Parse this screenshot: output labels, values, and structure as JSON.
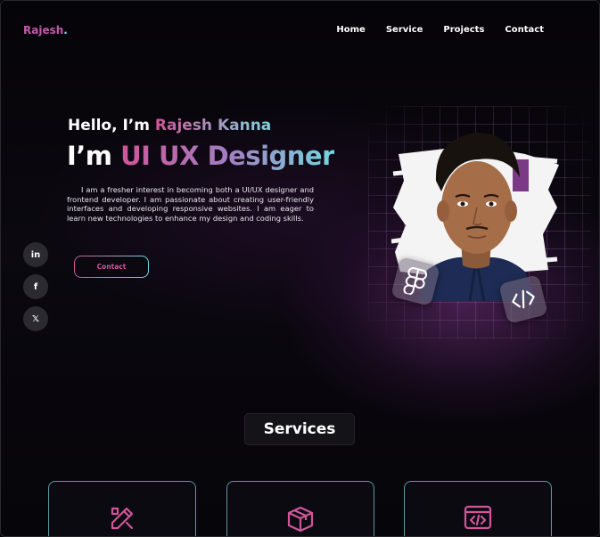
{
  "brand": {
    "name": "Rajesh",
    "dot": ".",
    "accent": "#c45aa8",
    "accent2": "#8fd8e6"
  },
  "nav": {
    "items": [
      "Home",
      "Service",
      "Projects",
      "Contact"
    ]
  },
  "hero": {
    "greeting": "Hello, I’m ",
    "name": "Rajesh Kanna",
    "role_prefix": "I’m ",
    "role": "UI UX Designer",
    "intro": "I am a fresher interest in becoming both a UI/UX designer and frontend developer. I am passionate about creating user-friendly interfaces and developing responsive websites. I am eager to learn new technologies to enhance my design and coding skills.",
    "contact_button": "Contact"
  },
  "socials": [
    {
      "icon": "linkedin-icon",
      "glyph": "in"
    },
    {
      "icon": "facebook-icon",
      "glyph": "f"
    },
    {
      "icon": "x-twitter-icon",
      "glyph": "𝕏"
    }
  ],
  "badges": {
    "left": "figma-icon",
    "right": "code-icon"
  },
  "services": {
    "title": "Services",
    "cards": [
      {
        "icon": "design-tools-icon"
      },
      {
        "icon": "package-box-icon"
      },
      {
        "icon": "code-window-icon"
      }
    ]
  }
}
